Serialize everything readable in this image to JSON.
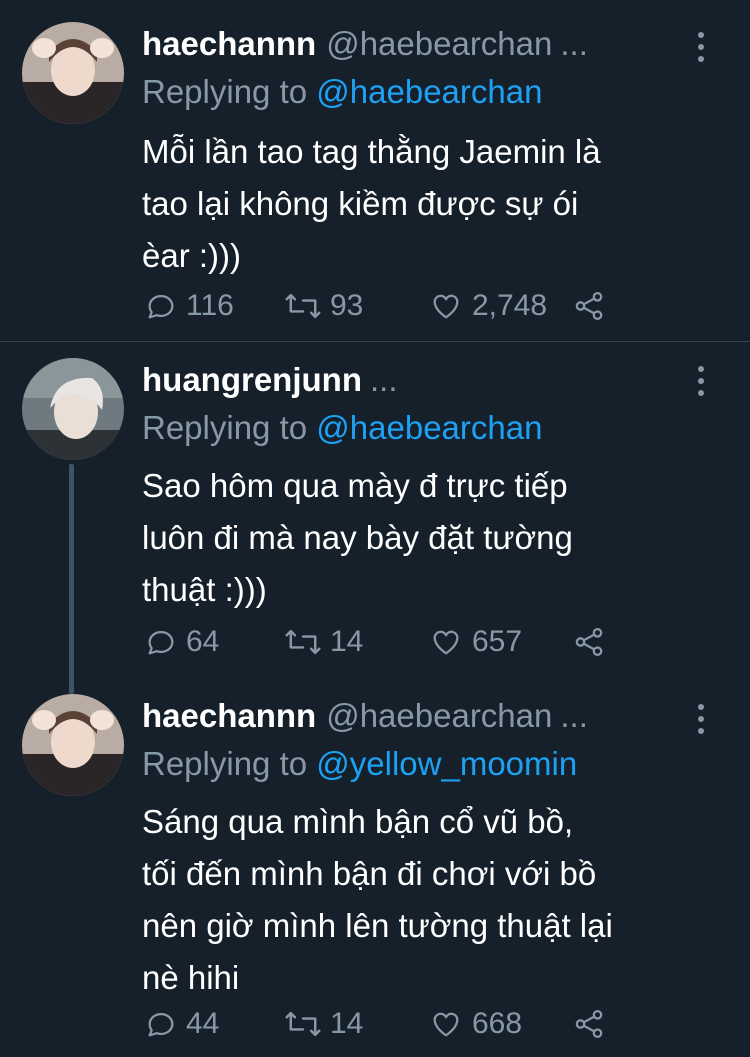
{
  "tweets": [
    {
      "name": "haechannn",
      "handle": "@haebearchan",
      "ellipsis": "...",
      "replying_prefix": "Replying to",
      "replying_to": "@haebearchan",
      "text": "Mỗi lần tao tag thằng Jaemin là\ntao lại không kiềm được sự ói\nèar :)))",
      "replies": "116",
      "retweets": "93",
      "likes": "2,748"
    },
    {
      "name": "huangrenjunn",
      "handle": "",
      "ellipsis": "...",
      "replying_prefix": "Replying to",
      "replying_to": "@haebearchan",
      "text": "Sao hôm qua mày đ trực tiếp\nluôn đi mà nay bày đặt tường\nthuật :)))",
      "replies": "64",
      "retweets": "14",
      "likes": "657"
    },
    {
      "name": "haechannn",
      "handle": "@haebearchan",
      "ellipsis": "...",
      "replying_prefix": "Replying to",
      "replying_to": "@yellow_moomin",
      "text": "Sáng qua mình bận cổ vũ bồ,\ntối đến mình bận đi chơi với bồ\nnên giờ mình lên tường thuật lại\nnè hihi",
      "replies": "44",
      "retweets": "14",
      "likes": "668"
    }
  ],
  "colors": {
    "background": "#15202b",
    "secondary_text": "#8899a6",
    "link": "#1da1f2",
    "divider": "#38444d"
  }
}
